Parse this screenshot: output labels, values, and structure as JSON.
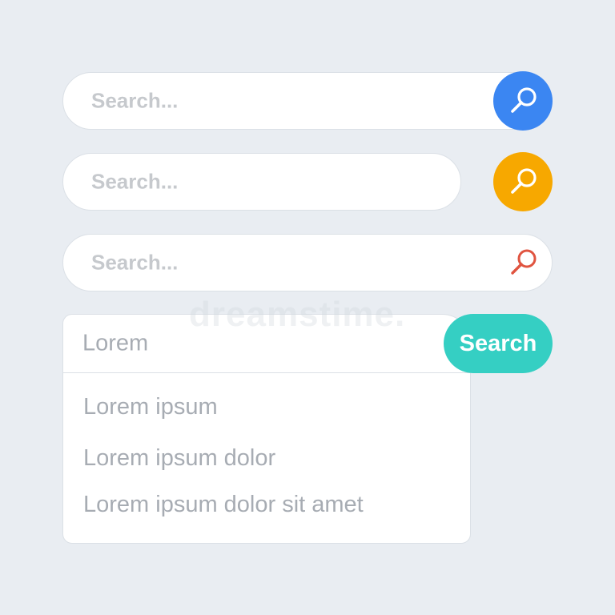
{
  "colors": {
    "background": "#e9edf2",
    "blue_button": "#3b86f2",
    "orange_button": "#f7a800",
    "red_icon": "#e05440",
    "teal_button": "#35cfc3",
    "placeholder_text": "#c6c9cd",
    "suggestion_text": "#a7acb3"
  },
  "search_bar_1": {
    "placeholder": "Search...",
    "button_icon": "magnifier-icon"
  },
  "search_bar_2": {
    "placeholder": "Search...",
    "button_icon": "magnifier-icon"
  },
  "search_bar_3": {
    "placeholder": "Search...",
    "icon": "magnifier-icon"
  },
  "search_bar_4": {
    "value": "Lorem",
    "button_label": "Search",
    "suggestions": [
      "Lorem ipsum",
      "Lorem ipsum dolor",
      "Lorem ipsum dolor sit amet"
    ]
  },
  "watermark": {
    "text": "dreamstime."
  }
}
